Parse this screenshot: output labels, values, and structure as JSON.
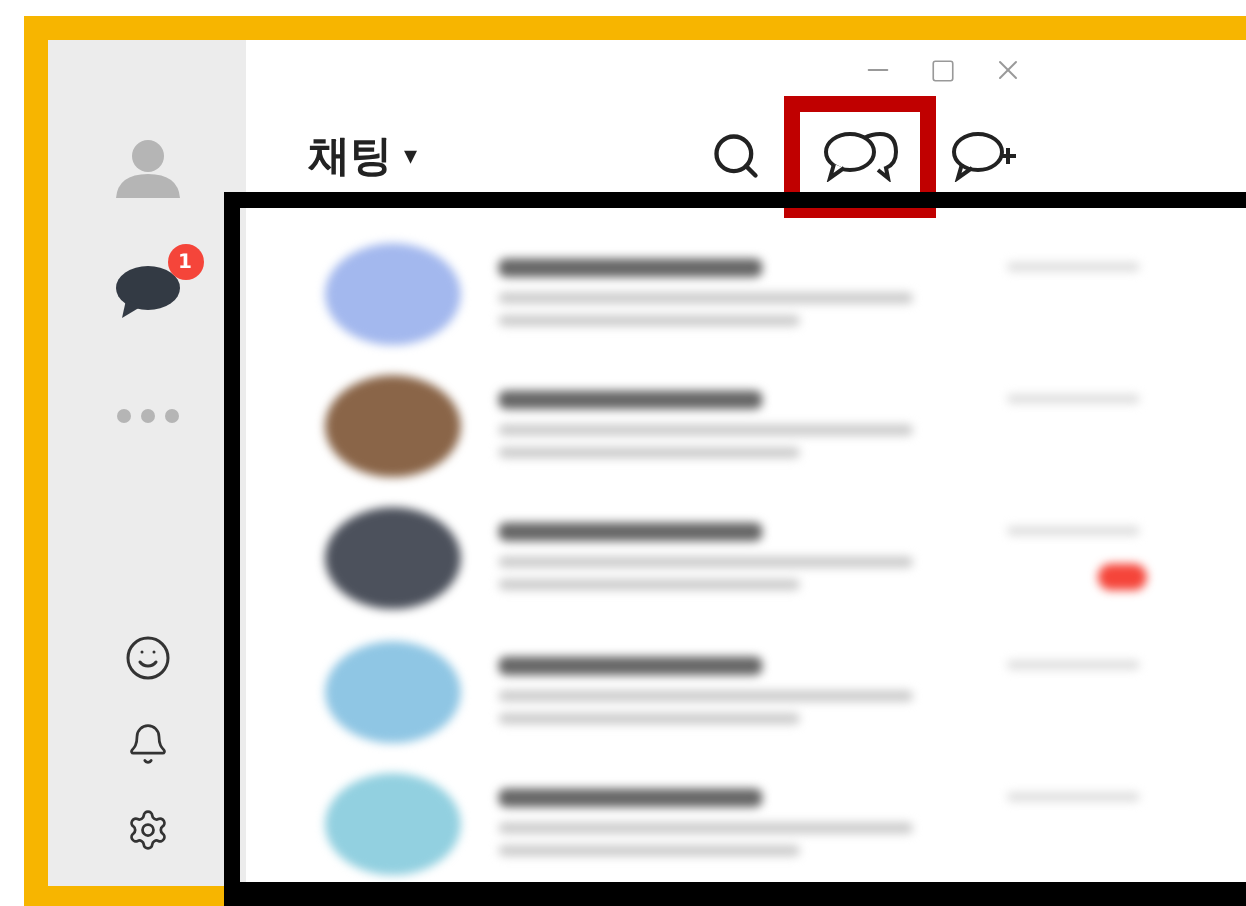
{
  "sidebar": {
    "items": [
      {
        "kind": "friends",
        "selected": false
      },
      {
        "kind": "chats",
        "selected": true,
        "badge": "1"
      },
      {
        "kind": "more",
        "selected": false
      }
    ],
    "bottom_items": [
      {
        "kind": "emoticon"
      },
      {
        "kind": "notifications"
      },
      {
        "kind": "settings"
      }
    ]
  },
  "header": {
    "title": "채팅",
    "dropdown": "▾"
  },
  "toolbar": [
    {
      "kind": "search",
      "highlighted": false
    },
    {
      "kind": "open-chats",
      "highlighted": true
    },
    {
      "kind": "new-chat",
      "highlighted": false
    }
  ],
  "chat_list": {
    "outlined": true,
    "rows": [
      {
        "color": "#a3b8ee",
        "unread": false
      },
      {
        "color": "#8a6548",
        "unread": false
      },
      {
        "color": "#4c515c",
        "unread": true
      },
      {
        "color": "#8fc6e4",
        "unread": false
      },
      {
        "color": "#92d0e0",
        "unread": false
      }
    ]
  }
}
